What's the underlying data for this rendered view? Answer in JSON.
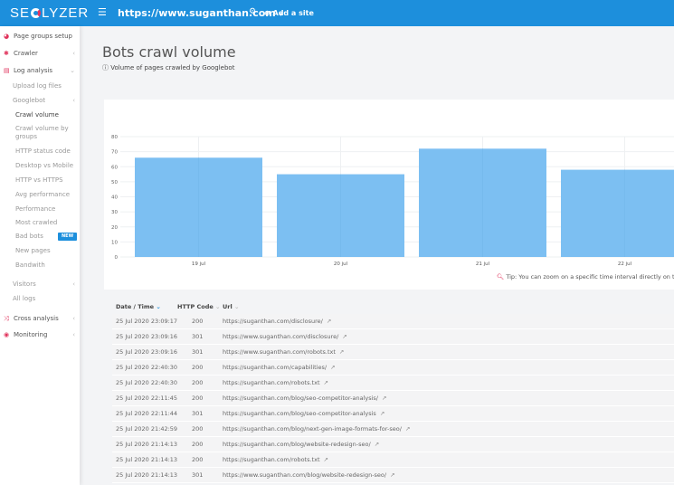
{
  "header": {
    "logo": "SEOLYZER",
    "logo_left": "SE",
    "logo_right": "LYZER",
    "site": "https://www.suganthan.com",
    "add_site": "Add a site"
  },
  "sidebar": {
    "items": [
      {
        "label": "Page groups setup",
        "icon": "pie-icon"
      },
      {
        "label": "Crawler",
        "icon": "spider-icon"
      },
      {
        "label": "Log analysis",
        "icon": "file-icon"
      },
      {
        "label": "Upload log files"
      },
      {
        "label": "Googlebot"
      },
      {
        "label": "Crawl volume"
      },
      {
        "label": "Crawl volume by groups"
      },
      {
        "label": "HTTP status code"
      },
      {
        "label": "Desktop vs Mobile"
      },
      {
        "label": "HTTP vs HTTPS"
      },
      {
        "label": "Avg performance"
      },
      {
        "label": "Performance"
      },
      {
        "label": "Most crawled"
      },
      {
        "label": "Bad bots",
        "badge": "NEW"
      },
      {
        "label": "New pages"
      },
      {
        "label": "Bandwith"
      },
      {
        "label": "Visitors"
      },
      {
        "label": "All logs"
      },
      {
        "label": "Cross analysis",
        "icon": "shuffle-icon"
      },
      {
        "label": "Monitoring",
        "icon": "pulse-icon"
      }
    ]
  },
  "page": {
    "title": "Bots crawl volume",
    "subtitle": "Volume of pages crawled by Googlebot",
    "tip": "Tip: You can zoom on a specific time interval directly on the cha"
  },
  "chart_data": {
    "type": "bar",
    "categories": [
      "19 jul",
      "20 jul",
      "21 jul",
      "22 jul"
    ],
    "values": [
      66,
      55,
      72,
      58
    ],
    "ylim": [
      0,
      80
    ],
    "yticks": [
      0,
      10,
      20,
      30,
      40,
      50,
      60,
      70,
      80
    ],
    "grid": true,
    "color": "#7cbff2"
  },
  "table": {
    "headers": [
      "Date / Time",
      "HTTP Code",
      "Url"
    ],
    "rows": [
      [
        "25 Jul 2020 23:09:17",
        "200",
        "https://suganthan.com/disclosure/"
      ],
      [
        "25 Jul 2020 23:09:16",
        "301",
        "https://www.suganthan.com/disclosure/"
      ],
      [
        "25 Jul 2020 23:09:16",
        "301",
        "https://www.suganthan.com/robots.txt"
      ],
      [
        "25 Jul 2020 22:40:30",
        "200",
        "https://suganthan.com/capabilities/"
      ],
      [
        "25 Jul 2020 22:40:30",
        "200",
        "https://suganthan.com/robots.txt"
      ],
      [
        "25 Jul 2020 22:11:45",
        "200",
        "https://suganthan.com/blog/seo-competitor-analysis/"
      ],
      [
        "25 Jul 2020 22:11:44",
        "301",
        "https://suganthan.com/blog/seo-competitor-analysis"
      ],
      [
        "25 Jul 2020 21:42:59",
        "200",
        "https://suganthan.com/blog/next-gen-image-formats-for-seo/"
      ],
      [
        "25 Jul 2020 21:14:13",
        "200",
        "https://suganthan.com/blog/website-redesign-seo/"
      ],
      [
        "25 Jul 2020 21:14:13",
        "200",
        "https://suganthan.com/robots.txt"
      ],
      [
        "25 Jul 2020 21:14:13",
        "301",
        "https://www.suganthan.com/blog/website-redesign-seo/"
      ]
    ]
  }
}
